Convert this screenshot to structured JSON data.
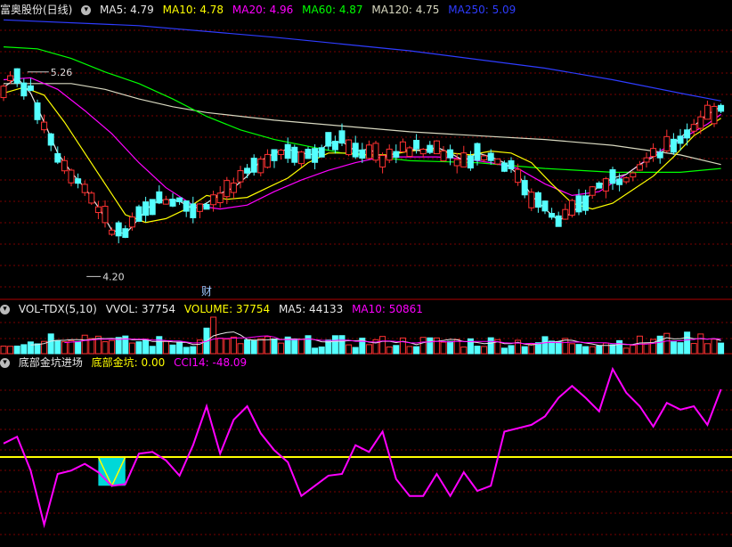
{
  "price_header": {
    "stock_name": "富奥股份(日线)",
    "ma5": "MA5: 4.79",
    "ma10": "MA10: 4.78",
    "ma20": "MA20: 4.96",
    "ma60": "MA60: 4.87",
    "ma120": "MA120: 4.75",
    "ma250": "MA250: 5.09"
  },
  "volume_header": {
    "name": "VOL-TDX(5,10)",
    "vvol": "VVOL: 37754",
    "volume": "VOLUME: 37754",
    "ma5": "MA5: 44133",
    "ma10": "MA10: 50861"
  },
  "indicator_header": {
    "name": "底部金坑进场",
    "pit": "底部金坑: 0.00",
    "cci": "CCI14: -48.09"
  },
  "annotations": {
    "high_label": "5.26",
    "low_label": "4.20",
    "finance_marker": "财"
  },
  "colors": {
    "background": "#000000",
    "grid": "#7a0000",
    "up": "#ff3232",
    "down": "#54ffff",
    "ma5": "#e6e6e6",
    "ma10": "#ffff00",
    "ma20": "#ff00ff",
    "ma60": "#00ff00",
    "ma120": "#d8d8c0",
    "ma250": "#2e3cff",
    "cci": "#ff00ff",
    "threshold": "#ffff00",
    "pit_fill": "#00d8d8"
  },
  "chart_data": [
    {
      "type": "candlestick",
      "name": "price",
      "ylim": [
        4.1,
        5.55
      ],
      "grid": true,
      "ma_lines": {
        "ma250": {
          "x": [
            0,
            20,
            40,
            60,
            80,
            90,
            100,
            106
          ],
          "y": [
            5.53,
            5.5,
            5.44,
            5.37,
            5.28,
            5.22,
            5.15,
            5.11
          ]
        },
        "ma120": {
          "x": [
            0,
            5,
            10,
            15,
            20,
            25,
            30,
            40,
            50,
            60,
            70,
            80,
            90,
            100,
            106
          ],
          "y": [
            5.2,
            5.2,
            5.2,
            5.17,
            5.12,
            5.08,
            5.05,
            5.01,
            4.98,
            4.95,
            4.93,
            4.91,
            4.88,
            4.83,
            4.78
          ]
        },
        "ma60": {
          "x": [
            0,
            5,
            10,
            15,
            20,
            25,
            30,
            35,
            40,
            50,
            60,
            70,
            80,
            90,
            100,
            106
          ],
          "y": [
            5.39,
            5.38,
            5.33,
            5.26,
            5.2,
            5.12,
            5.03,
            4.96,
            4.91,
            4.84,
            4.8,
            4.79,
            4.76,
            4.74,
            4.74,
            4.76
          ]
        },
        "ma20": {
          "x": [
            0,
            4,
            8,
            12,
            16,
            20,
            24,
            28,
            32,
            36,
            40,
            44,
            48,
            52,
            56,
            60,
            64,
            68,
            72,
            76,
            80,
            84,
            88,
            92,
            96,
            100,
            104,
            106
          ],
          "y": [
            5.22,
            5.23,
            5.17,
            5.06,
            4.94,
            4.79,
            4.66,
            4.57,
            4.55,
            4.57,
            4.64,
            4.7,
            4.75,
            4.79,
            4.82,
            4.82,
            4.82,
            4.81,
            4.79,
            4.76,
            4.68,
            4.62,
            4.64,
            4.73,
            4.83,
            4.91,
            4.99,
            5.04
          ]
        },
        "ma10": {
          "x": [
            0,
            3,
            6,
            9,
            12,
            15,
            18,
            21,
            24,
            27,
            30,
            33,
            36,
            39,
            42,
            45,
            48,
            51,
            54,
            57,
            60,
            63,
            66,
            69,
            72,
            75,
            78,
            81,
            84,
            87,
            90,
            93,
            96,
            99,
            102,
            106
          ],
          "y": [
            5.15,
            5.18,
            5.14,
            5.0,
            4.84,
            4.68,
            4.52,
            4.48,
            4.5,
            4.55,
            4.62,
            4.6,
            4.61,
            4.66,
            4.71,
            4.79,
            4.84,
            4.84,
            4.83,
            4.83,
            4.85,
            4.86,
            4.84,
            4.83,
            4.85,
            4.84,
            4.79,
            4.68,
            4.58,
            4.55,
            4.58,
            4.65,
            4.72,
            4.82,
            4.93,
            5.02
          ]
        },
        "ma5": {
          "x": [
            0,
            2,
            4,
            6,
            8,
            10,
            12,
            14,
            16,
            18,
            20,
            22,
            24,
            26,
            28,
            30,
            32,
            34,
            36,
            38,
            40,
            42,
            44,
            46,
            48,
            50,
            52,
            54,
            56,
            58,
            60,
            62,
            64,
            66,
            68,
            70,
            72,
            74,
            76,
            78,
            80,
            82,
            84,
            86,
            88,
            90,
            92,
            94,
            96,
            98,
            100,
            102,
            104,
            106
          ],
          "y": [
            5.18,
            5.23,
            5.15,
            5.0,
            4.84,
            4.74,
            4.66,
            4.56,
            4.44,
            4.42,
            4.5,
            4.58,
            4.6,
            4.59,
            4.55,
            4.58,
            4.63,
            4.66,
            4.72,
            4.8,
            4.84,
            4.86,
            4.84,
            4.83,
            4.89,
            4.9,
            4.85,
            4.86,
            4.82,
            4.84,
            4.86,
            4.85,
            4.87,
            4.84,
            4.8,
            4.84,
            4.82,
            4.79,
            4.73,
            4.62,
            4.55,
            4.49,
            4.53,
            4.6,
            4.67,
            4.71,
            4.73,
            4.78,
            4.82,
            4.86,
            4.92,
            4.98,
            5.04,
            5.08
          ]
        }
      }
    },
    {
      "type": "bar",
      "name": "volume",
      "ylim": [
        0,
        1
      ],
      "grid": true
    },
    {
      "type": "line",
      "name": "CCI14",
      "ylim": [
        -250,
        250
      ],
      "threshold": 0,
      "cci": {
        "x": [
          0,
          2,
          4,
          6,
          8,
          10,
          12,
          14,
          16,
          18,
          20,
          22,
          24,
          26,
          28,
          30,
          32,
          34,
          36,
          38,
          40,
          42,
          44,
          46,
          48,
          50,
          52,
          54,
          56,
          58,
          60,
          62,
          64,
          66,
          68,
          70,
          72,
          74,
          76,
          78,
          80,
          82,
          84,
          86,
          88,
          90,
          92,
          94,
          96,
          98,
          100,
          102,
          104,
          106
        ],
        "y": [
          40,
          60,
          -40,
          -200,
          -50,
          -40,
          -20,
          -45,
          -85,
          -80,
          10,
          15,
          -10,
          -55,
          35,
          150,
          10,
          110,
          150,
          70,
          20,
          -15,
          -115,
          -85,
          -55,
          -50,
          35,
          15,
          75,
          -65,
          -115,
          -115,
          -50,
          -115,
          -45,
          -100,
          -85,
          75,
          85,
          95,
          120,
          175,
          210,
          175,
          135,
          260,
          190,
          150,
          90,
          160,
          140,
          150,
          95,
          200
        ]
      },
      "pit_band": {
        "x_start": 14,
        "x_end": 18,
        "y": -85
      }
    }
  ]
}
